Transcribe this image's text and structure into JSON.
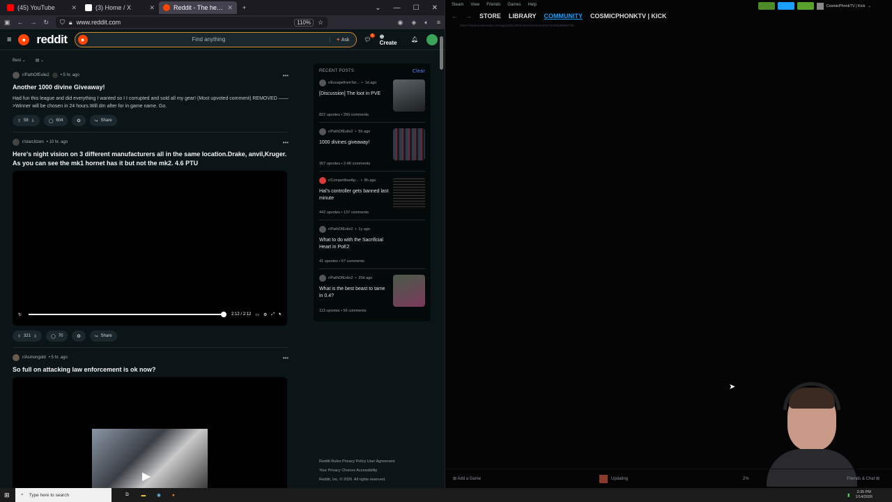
{
  "browser": {
    "tabs": [
      {
        "title": "(45) YouTube",
        "color": "#ff0000",
        "active": false
      },
      {
        "title": "(3) Home / X",
        "color": "#ffffff",
        "active": false
      },
      {
        "title": "Reddit - The heart of the internet",
        "color": "#ff4500",
        "active": true
      }
    ],
    "new_tab": "+",
    "url": "www.reddit.com",
    "zoom": "110%"
  },
  "reddit": {
    "logo": "reddit",
    "search_placeholder": "Find anything",
    "ask_label": "Ask",
    "create_label": "Create",
    "chat_badge": "1",
    "sort_label": "Best",
    "posts": [
      {
        "subreddit": "r/PathOfExile2",
        "age": "5 hr. ago",
        "title": "Another 1000 divine Giveaway!",
        "body": "Had fun this league and did everything I wanted so I I corrupted and sold all my gear! (Most upvoted comment) REMOVED ——>Winner will be chosen in 24 hours.Will dm after for in game name. Go.",
        "votes": "58",
        "comments": "604",
        "share": "Share"
      },
      {
        "subreddit": "r/starcitizen",
        "age": "10 hr. ago",
        "title": "Here's night vision on 3 different manufacturers all in the same location.Drake, anvil,Kruger. As you can see the mk1 hornet has it but not the mk2. 4.6 PTU",
        "time": "2:12 / 2:12",
        "progress": 1.0,
        "votes": "321",
        "comments": "70",
        "share": "Share"
      },
      {
        "subreddit": "r/Asmongold",
        "age": "5 hr. ago",
        "title": "So full on attacking law enforcement is ok now?"
      }
    ],
    "recent": {
      "heading": "RECENT POSTS",
      "clear": "Clear",
      "items": [
        {
          "sub": "r/EscapefromTar...",
          "age": "1d ago",
          "title": "[Discussion] The loot in PVE",
          "upvotes": "822 upvotes",
          "comments": "265 comments",
          "thumb": true
        },
        {
          "sub": "r/PathOfExile2",
          "age": "5h ago",
          "title": "1000 divines giveaway!",
          "upvotes": "307 upvotes",
          "comments": "2.4K comments",
          "thumb": true
        },
        {
          "sub": "r/CompetitiveAp...",
          "age": "8h ago",
          "title": "Hal's controller gets banned last minute",
          "upvotes": "442 upvotes",
          "comments": "137 comments",
          "thumb": true
        },
        {
          "sub": "r/PathOfExile2",
          "age": "1y ago",
          "title": "What to do with the Sacrificial Heart in PoE2",
          "upvotes": "41 upvotes",
          "comments": "67 comments",
          "thumb": false
        },
        {
          "sub": "r/PathOfExile2",
          "age": "20d ago",
          "title": "What is the best beast to tame in 0.4?",
          "upvotes": "113 upvotes",
          "comments": "56 comments",
          "thumb": true
        }
      ]
    },
    "footer": {
      "line1": "Reddit Rules   Privacy Policy   User Agreement",
      "line2": "Your Privacy Choices   Accessibility",
      "line3": "Reddit, Inc. © 2026. All rights reserved."
    }
  },
  "steam": {
    "menu": [
      "Steam",
      "View",
      "Friends",
      "Games",
      "Help"
    ],
    "nav": [
      "STORE",
      "LIBRARY",
      "COMMUNITY",
      "COSMICPHONKTV | KICK"
    ],
    "active_nav": "COMMUNITY",
    "url": "https://steamcommunity.com/app/2651280/eventcomments/609746295486984736",
    "user": "CosmicPhonkTV | Kick",
    "add_game": "Add a Game",
    "updating": "Updating",
    "update_pct": "2%",
    "friends_chat": "Friends & Chat"
  },
  "taskbar": {
    "search_placeholder": "Type here to search",
    "time": "3:35 PM",
    "date": "1/14/2026"
  }
}
